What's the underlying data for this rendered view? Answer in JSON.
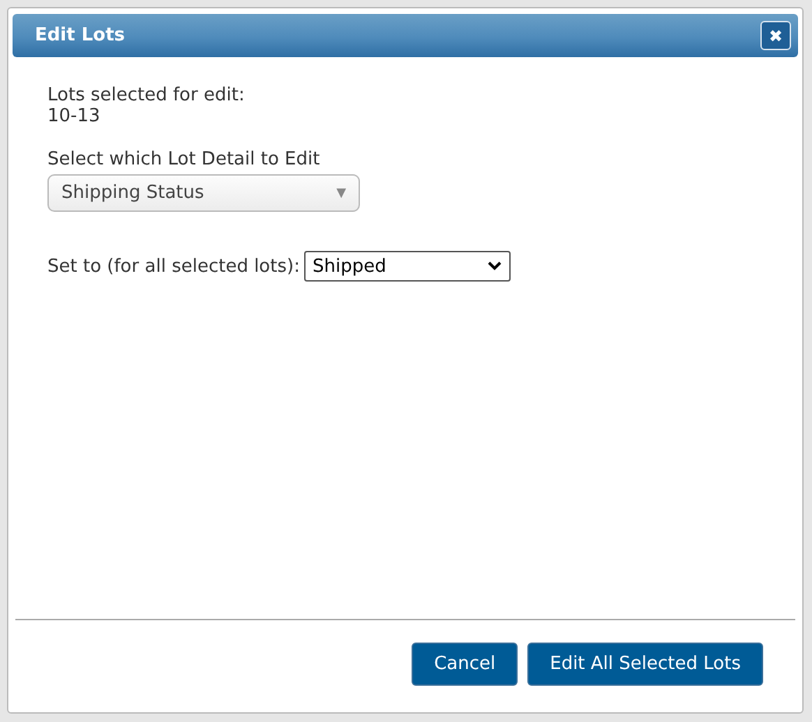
{
  "dialog": {
    "title": "Edit Lots",
    "close_label": "✖"
  },
  "lots_label": "Lots selected for edit:",
  "lots_value": "10-13",
  "detail_label": "Select which Lot Detail to Edit",
  "detail_select": {
    "value": "Shipping Status",
    "arrow": "▼"
  },
  "set_label": "Set to (for all selected lots):",
  "set_select": {
    "value": "Shipped"
  },
  "buttons": [
    {
      "label": "Cancel"
    },
    {
      "label": "Edit All Selected Lots"
    }
  ]
}
